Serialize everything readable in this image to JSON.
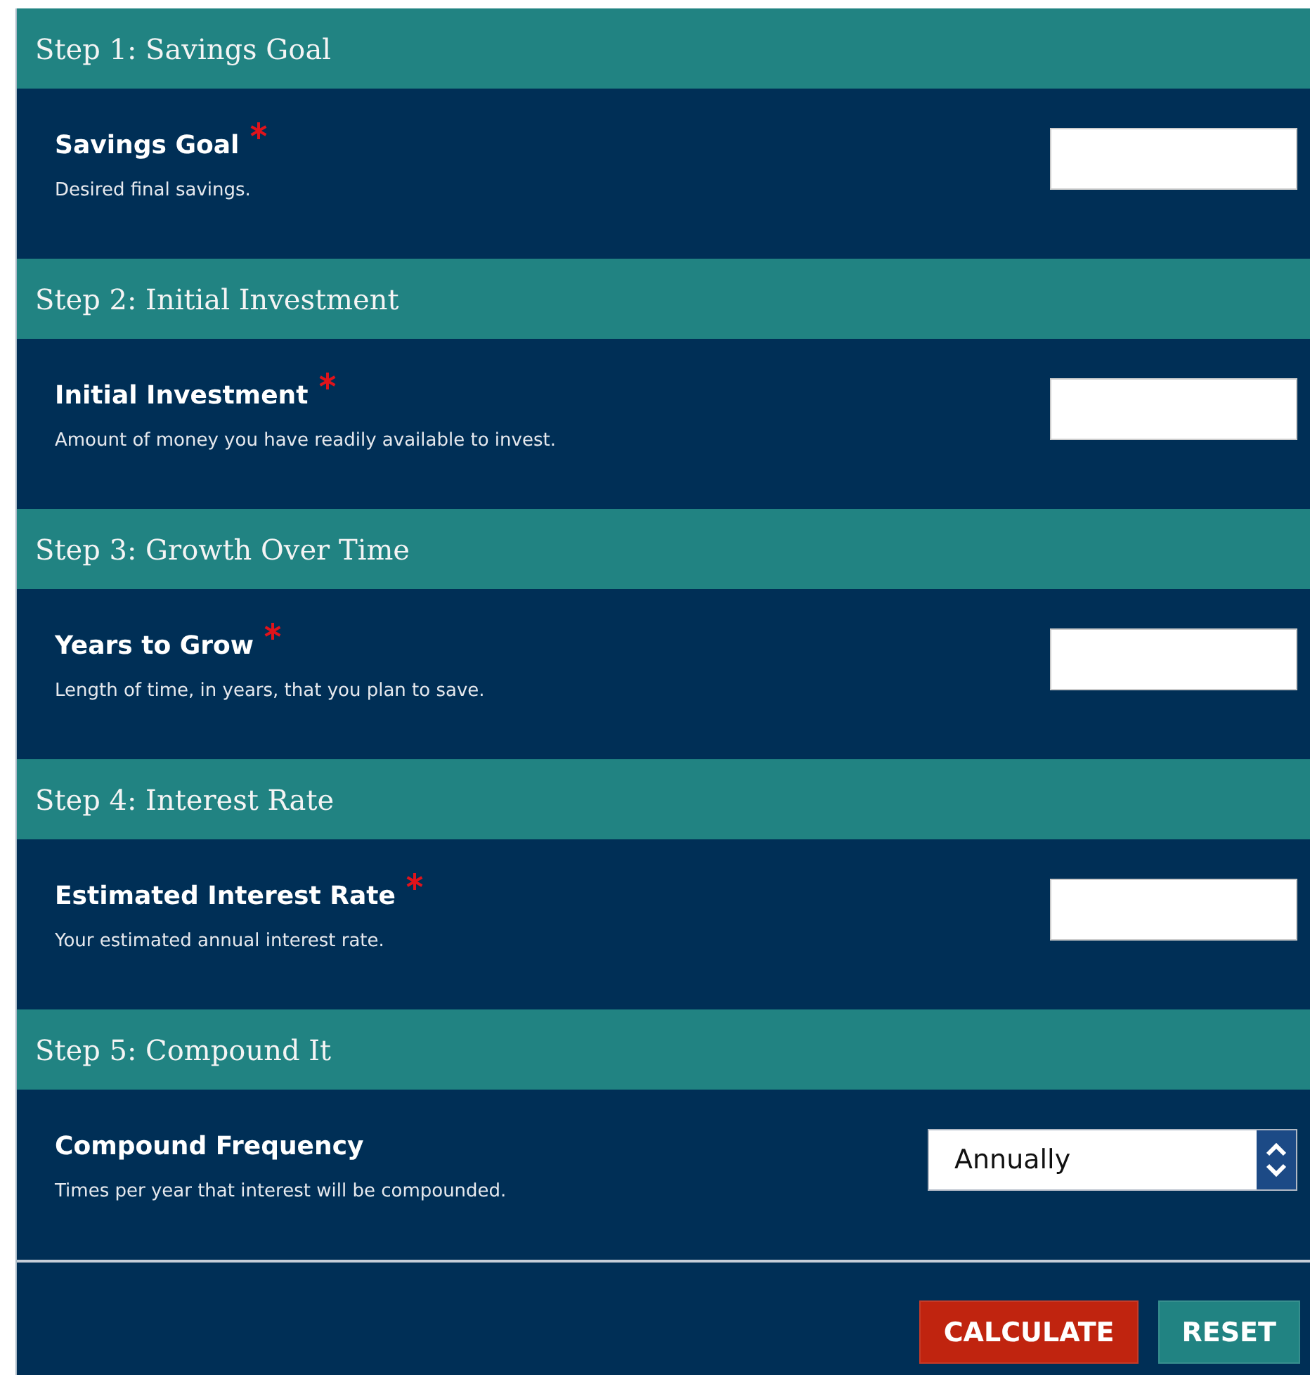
{
  "steps": [
    {
      "title": "Step 1: Savings Goal",
      "label": "Savings Goal",
      "required": true,
      "help": "Desired final savings.",
      "kind": "input"
    },
    {
      "title": "Step 2: Initial Investment",
      "label": "Initial Investment",
      "required": true,
      "help": "Amount of money you have readily available to invest.",
      "kind": "input"
    },
    {
      "title": "Step 3: Growth Over Time",
      "label": "Years to Grow",
      "required": true,
      "help": "Length of time, in years, that you plan to save.",
      "kind": "input"
    },
    {
      "title": "Step 4: Interest Rate",
      "label": "Estimated Interest Rate",
      "required": true,
      "help": "Your estimated annual interest rate.",
      "kind": "input"
    },
    {
      "title": "Step 5: Compound It",
      "label": "Compound Frequency",
      "required": false,
      "help": "Times per year that interest will be compounded.",
      "kind": "select",
      "value": "Annually"
    }
  ],
  "buttons": [
    {
      "label": "CALCULATE",
      "kind": "primary"
    },
    {
      "label": "RESET",
      "kind": "secondary"
    }
  ]
}
